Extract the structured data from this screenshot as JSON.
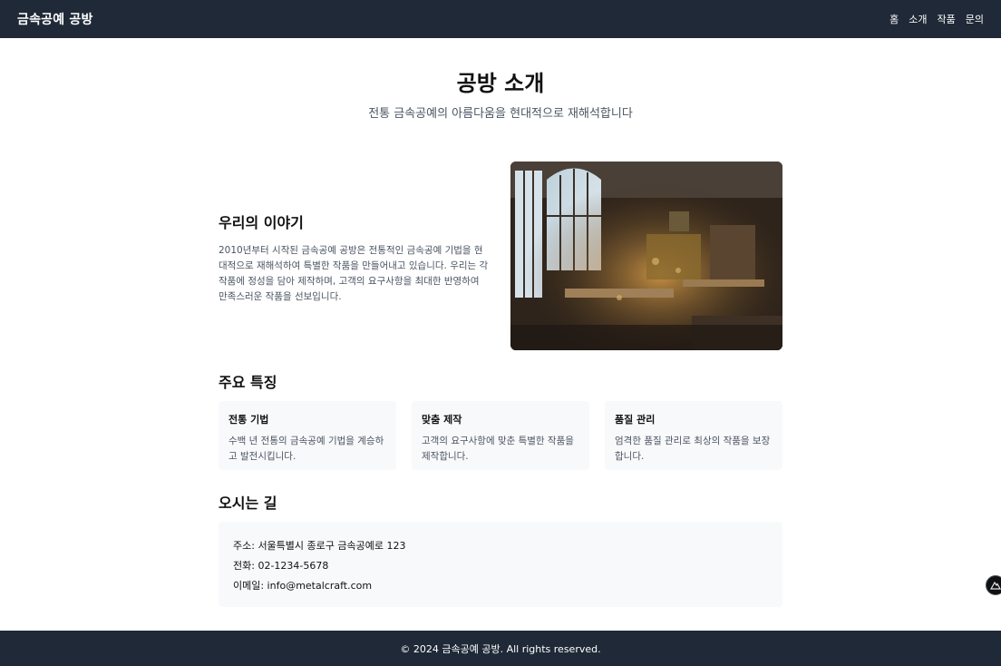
{
  "navbar": {
    "brand": "금속공예 공방",
    "links": [
      "홈",
      "소개",
      "작품",
      "문의"
    ]
  },
  "hero": {
    "title": "공방 소개",
    "subtitle": "전통 금속공예의 아름다움을 현대적으로 재해석합니다"
  },
  "story": {
    "title": "우리의 이야기",
    "text": "2010년부터 시작된 금속공예 공방은 전통적인 금속공예 기법을 현대적으로 재해석하여 특별한 작품을 만들어내고 있습니다. 우리는 각 작품에 정성을 담아 제작하며, 고객의 요구사항을 최대한 반영하여 만족스러운 작품을 선보입니다.",
    "image_icon": "workshop-photo"
  },
  "features": {
    "title": "주요 특징",
    "items": [
      {
        "title": "전통 기법",
        "desc": "수백 년 전통의 금속공예 기법을 계승하고 발전시킵니다."
      },
      {
        "title": "맞춤 제작",
        "desc": "고객의 요구사항에 맞춘 특별한 작품을 제작합니다."
      },
      {
        "title": "품질 관리",
        "desc": "엄격한 품질 관리로 최상의 작품을 보장합니다."
      }
    ]
  },
  "location": {
    "title": "오시는 길",
    "address": "주소: 서울특별시 종로구 금속공예로 123",
    "phone": "전화: 02-1234-5678",
    "email": "이메일: info@metalcraft.com"
  },
  "footer": {
    "text": "© 2024 금속공예 공방. All rights reserved."
  },
  "colors": {
    "navbar_bg": "#1f2937",
    "card_bg": "#f8f9fa",
    "muted_text": "#4b5563"
  }
}
